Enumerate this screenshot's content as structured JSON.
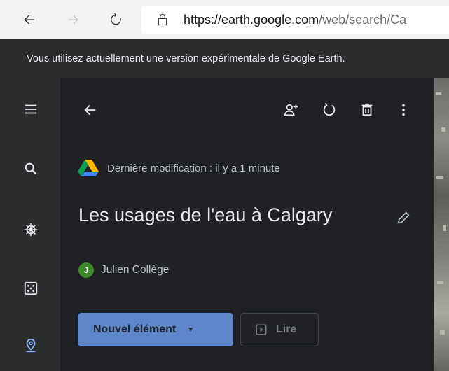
{
  "browser": {
    "url_main": "https://earth.google.com",
    "url_rest": "/web/search/Ca"
  },
  "notice": {
    "text": "Vous utilisez actuellement une version expérimentale de Google Earth."
  },
  "rail": {
    "items": [
      "menu-icon",
      "search-icon",
      "voyager-icon",
      "feeling-lucky-icon",
      "projects-icon"
    ]
  },
  "panel": {
    "last_modified": "Dernière modification : il y a 1 minute",
    "title": "Les usages de l'eau à Calgary",
    "author_initial": "J",
    "author_name": "Julien Collège",
    "new_button_label": "Nouvel élément",
    "play_button_label": "Lire"
  },
  "colors": {
    "panel_bg": "#202124",
    "rail_bg": "#2b2c2e",
    "primary_button": "#5e86c8",
    "avatar": "#3f8a2e"
  }
}
